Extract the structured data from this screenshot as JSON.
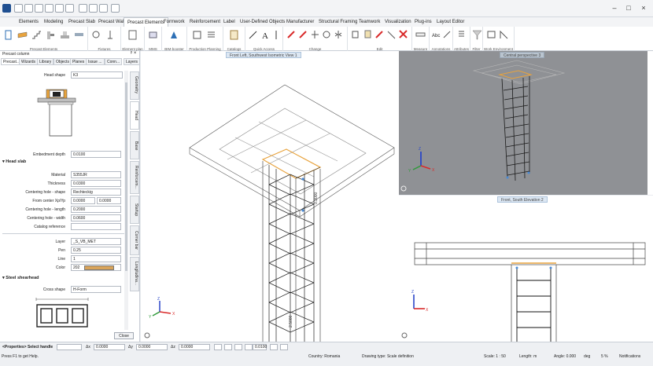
{
  "window": {
    "tabs": [
      "Elements",
      "Modeling",
      "Precast Slab",
      "Precast Wall",
      "Precast Elements",
      "Formwork",
      "Reinforcement",
      "Label",
      "User-Defined Objects",
      "Manufacturer",
      "Structural Framing",
      "Teamwork",
      "Visualization",
      "Plug-ins",
      "Layout Editor"
    ],
    "active_tab": "Precast Elements"
  },
  "ribbon": {
    "groups": [
      "Precast Elements",
      "Fixtures",
      "Element plan",
      "MMS",
      "BIM-booster",
      "Production Planning",
      "Catalogs",
      "Quick Access",
      "Change",
      "Edit",
      "Measure",
      "Annotations",
      "Attributes",
      "Filter",
      "Work Environment"
    ]
  },
  "palette": {
    "title": "Precast column",
    "tabs": [
      "Precast...",
      "Wizards",
      "Library",
      "Objects",
      "Planes",
      "Issue ...",
      "Conn...",
      "Layers"
    ],
    "side_tabs": [
      "Geometry",
      "Head",
      "Base",
      "Reinforcem...",
      "Startup",
      "Corner bar",
      "Longitudina..."
    ],
    "head_shape_label": "Head shape",
    "head_shape_value": "K3",
    "embedment_label": "Embedment depth",
    "embedment_value": "0.0100",
    "head_slab_section": "Head slab",
    "material_label": "Material",
    "material_value": "S355JR",
    "thickness_label": "Thickness",
    "thickness_value": "0.0300",
    "centering_shape_label": "Centering hole - shape",
    "centering_shape_value": "Rechteckig",
    "from_center_label": "From center Xp/Yp",
    "from_center_x": "0.0000",
    "from_center_y": "0.0000",
    "centering_length_label": "Centering hole - length",
    "centering_length_value": "0.2000",
    "centering_width_label": "Centering hole - width",
    "centering_width_value": "0.0600",
    "catalog_ref_label": "Catalog reference",
    "layer_label": "Layer",
    "layer_value": "_S_VB_MET",
    "pen_label": "Pen",
    "pen_value": "0.25",
    "line_label": "Line",
    "line_value": "1",
    "color_label": "Color",
    "color_value": "202",
    "color_swatch": "#d9a45a",
    "steel_section": "Steel shearhead",
    "cross_shape_label": "Cross shape",
    "cross_shape_value": "H-Form",
    "close_label": "Close"
  },
  "viewports": {
    "vp1_title": "Front Left, Southwest Isometric View 1",
    "vp2_title": "Central perspective 3",
    "vp3_title": "Front, South Elevation 2",
    "dim_a": "0.3000",
    "dim_b": "2.5000"
  },
  "statusbar": {
    "properties_label": "<Properties> Select handle",
    "dx_label": "Δx",
    "dx_value": "0.0000",
    "dy_label": "Δy",
    "dy_value": "0.0000",
    "dz_label": "Δz",
    "dz_value": "0.0000",
    "snap_value": "0.0100",
    "help_text": "Press F1 to get Help.",
    "country": "Country: Romania",
    "drawing_type": "Drawing type:  Scale definition",
    "scale": "Scale:  1 : 50",
    "length": "Length:  m",
    "angle": "Angle:  0.000",
    "angle_unit": "deg",
    "zoom": "5 %",
    "notifications": "Notifications"
  },
  "colors": {
    "accent": "#2d6fb5",
    "highlight": "#e8a33d",
    "axis_x": "#d92b2b",
    "axis_y": "#2f9a3a",
    "axis_z": "#2a46c8"
  }
}
